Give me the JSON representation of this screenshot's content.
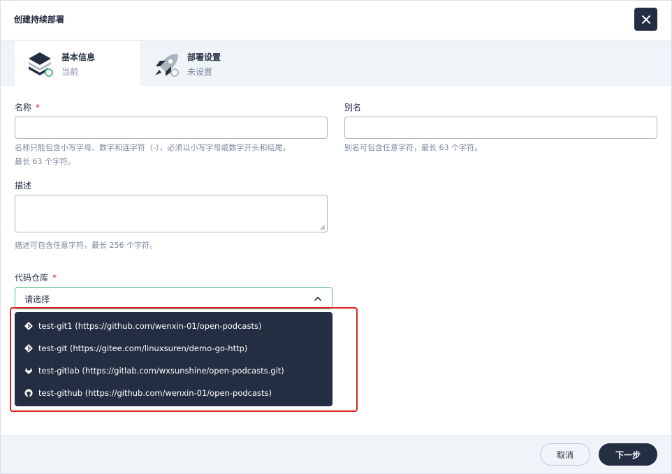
{
  "modal": {
    "title": "创建持续部署"
  },
  "steps": [
    {
      "title": "基本信息",
      "status": "当前"
    },
    {
      "title": "部署设置",
      "status": "未设置"
    }
  ],
  "form": {
    "name": {
      "label": "名称",
      "required_mark": "*",
      "value": "",
      "hint": [
        "名称只能包含小写字母、数字和连字符（-），必须以小写字母或数字开头和结尾，",
        "最长 63 个字符。"
      ]
    },
    "alias": {
      "label": "别名",
      "value": "",
      "hint": "别名可包含任意字符，最长 63 个字符。"
    },
    "description": {
      "label": "描述",
      "value": "",
      "hint": "描述可包含任意字符，最长 256 个字符。"
    },
    "code_repo": {
      "label": "代码仓库",
      "required_mark": "*",
      "placeholder": "请选择",
      "options": [
        {
          "icon": "git-icon",
          "label": "test-git1 (https://github.com/wenxin-01/open-podcasts)"
        },
        {
          "icon": "git-icon",
          "label": "test-git (https://gitee.com/linuxsuren/demo-go-http)"
        },
        {
          "icon": "gitlab-icon",
          "label": "test-gitlab (https://gitlab.com/wxsunshine/open-podcasts.git)"
        },
        {
          "icon": "github-icon",
          "label": "test-github (https://github.com/wenxin-01/open-podcasts)"
        }
      ]
    }
  },
  "footer": {
    "cancel_label": "取消",
    "next_label": "下一步"
  },
  "colors": {
    "dark": "#242e42",
    "accent_green": "#55bc8a",
    "required_red": "#ca2621",
    "highlight_red": "#e02020"
  }
}
